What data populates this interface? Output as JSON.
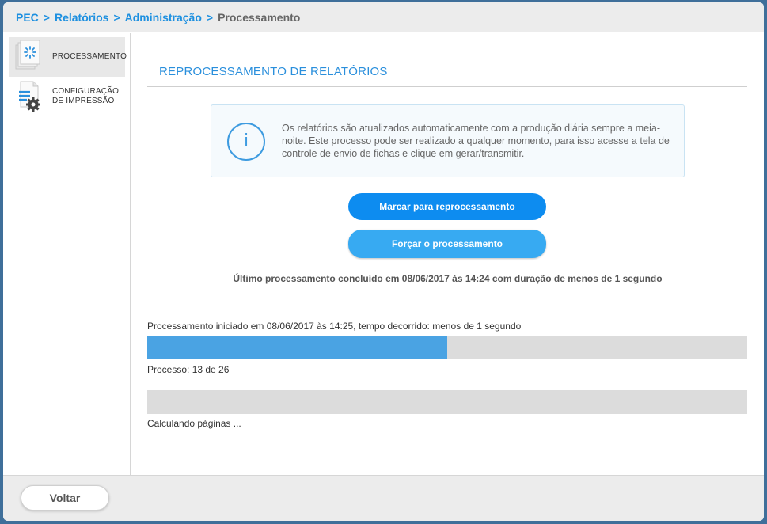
{
  "breadcrumb": {
    "items": [
      "PEC",
      "Relatórios",
      "Administração"
    ],
    "current": "Processamento",
    "separator": ">"
  },
  "sidebar": {
    "items": [
      {
        "label_line1": "PROCESSAMENTO",
        "label_line2": "",
        "icon": "processing-document-icon",
        "active": true
      },
      {
        "label_line1": "CONFIGURAÇÃO",
        "label_line2": "DE IMPRESSÃO",
        "icon": "print-settings-icon",
        "active": false
      }
    ]
  },
  "main": {
    "title": "REPROCESSAMENTO DE RELATÓRIOS",
    "info": {
      "icon": "info-icon",
      "icon_glyph": "i",
      "text": "Os relatórios são atualizados automaticamente com a produção diária sempre a meia-noite. Este processo pode ser realizado a qualquer momento, para isso acesse a tela de controle de envio de fichas e clique em gerar/transmitir."
    },
    "buttons": {
      "mark": "Marcar para reprocessamento",
      "force": "Forçar o processamento"
    },
    "last_processing": "Último processamento concluído em 08/06/2017 às 14:24 com duração de menos de 1 segundo",
    "progress1": {
      "label": "Processamento iniciado em 08/06/2017 às 14:25, tempo decorrido: menos de 1 segundo",
      "status": "Processo: 13 de 26",
      "fraction": 0.5
    },
    "progress2": {
      "status": "Calculando páginas ...",
      "fraction": 0
    }
  },
  "footer": {
    "back": "Voltar"
  },
  "colors": {
    "accent": "#1e90e0",
    "primary_button": "#0d8cf0",
    "secondary_button": "#37aaf2",
    "progress_fill": "#4aa3e3",
    "progress_track": "#dcdcdc"
  }
}
